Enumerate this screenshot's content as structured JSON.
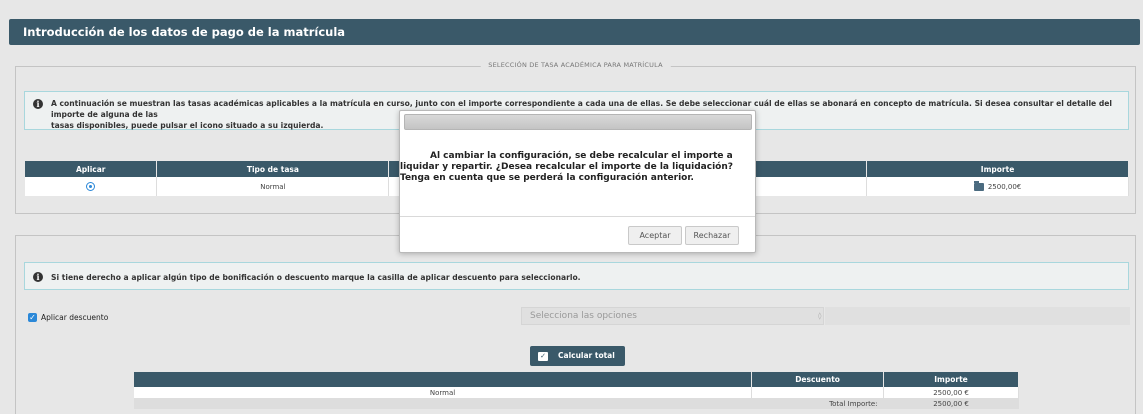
{
  "header": {
    "title": "Introducción de los datos de pago de la matrícula"
  },
  "section_rates": {
    "legend": "SELECCIÓN DE TASA ACADÉMICA PARA MATRÍCULA",
    "info_text_line1": "A continuación se muestran las tasas académicas aplicables a la matrícula en curso, junto con el importe correspondiente a cada una de ellas. Se debe seleccionar cuál de ellas se abonará en concepto de matrícula. Si desea consultar el detalle del importe de alguna de las",
    "info_text_line2": "tasas disponibles, puede pulsar el icono situado a su izquierda.",
    "table": {
      "headers": [
        "Aplicar",
        "Tipo de tasa",
        "",
        "Importe"
      ],
      "rows": [
        {
          "tipo": "Normal",
          "importe": "2500,00€"
        }
      ]
    }
  },
  "section_discount": {
    "info_text": "Si tiene derecho a aplicar algún tipo de bonificación o descuento marque la casilla de aplicar descuento para seleccionarlo.",
    "checkbox_label": "Aplicar descuento",
    "select_placeholder": "Selecciona las opciones",
    "calc_button": "Calcular total",
    "table": {
      "headers": [
        "",
        "Descuento",
        "Importe"
      ],
      "row": {
        "concept": "Normal",
        "importe": "2500,00 €"
      },
      "total_label": "Total Importe:",
      "total_value": "2500,00 €"
    }
  },
  "modal": {
    "message_line1": "Al cambiar la configuración, se debe recalcular el importe a",
    "message_rest": "liquidar y repartir. ¿Desea recalcular el importe de la liquidación? Tenga en cuenta que se perderá la configuración anterior.",
    "accept_label": "Aceptar",
    "reject_label": "Rechazar"
  },
  "colors": {
    "header": "#3a5969",
    "accent": "#2b88d8",
    "info_border": "#a8d7dd"
  }
}
